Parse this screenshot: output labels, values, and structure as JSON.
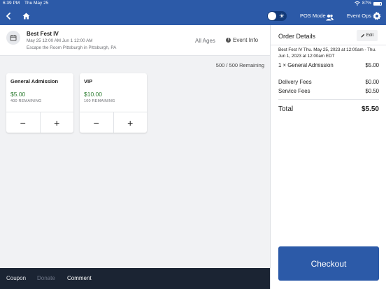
{
  "status_bar": {
    "time": "6:39 PM",
    "date": "Thu May 25",
    "battery": "87%"
  },
  "nav": {
    "pos_mode": "POS Mode",
    "event_ops": "Event Ops"
  },
  "event": {
    "title": "Best Fest IV",
    "dates": "May 25 12:00 AM Jun 1 12:00 AM",
    "venue": "Escape the Room Pittsburgh in Pittsburgh, PA",
    "ages": "All Ages",
    "info_label": "Event Info"
  },
  "remaining": "500 / 500 Remaining",
  "tickets": [
    {
      "name": "General Admission",
      "price": "$5.00",
      "remaining": "400 REMAINING"
    },
    {
      "name": "VIP",
      "price": "$10.00",
      "remaining": "100 REMAINING"
    }
  ],
  "stepper": {
    "minus": "−",
    "plus": "+"
  },
  "bottom_bar": {
    "coupon": "Coupon",
    "donate": "Donate",
    "comment": "Comment"
  },
  "order": {
    "title": "Order Details",
    "edit": "Edit",
    "event_line": "Best Fest IV Thu. May 25, 2023 at 12:00am - Thu. Jun 1, 2023 at 12:00am EDT",
    "item_label": "1 × General Admission",
    "item_amount": "$5.00",
    "delivery_label": "Delivery Fees",
    "delivery_amount": "$0.00",
    "service_label": "Service Fees",
    "service_amount": "$0.50",
    "total_label": "Total",
    "total_amount": "$5.50",
    "checkout": "Checkout"
  },
  "colors": {
    "primary": "#2c5aa8",
    "price_green": "#2e7d32",
    "bottom_bar": "#1b2433"
  }
}
